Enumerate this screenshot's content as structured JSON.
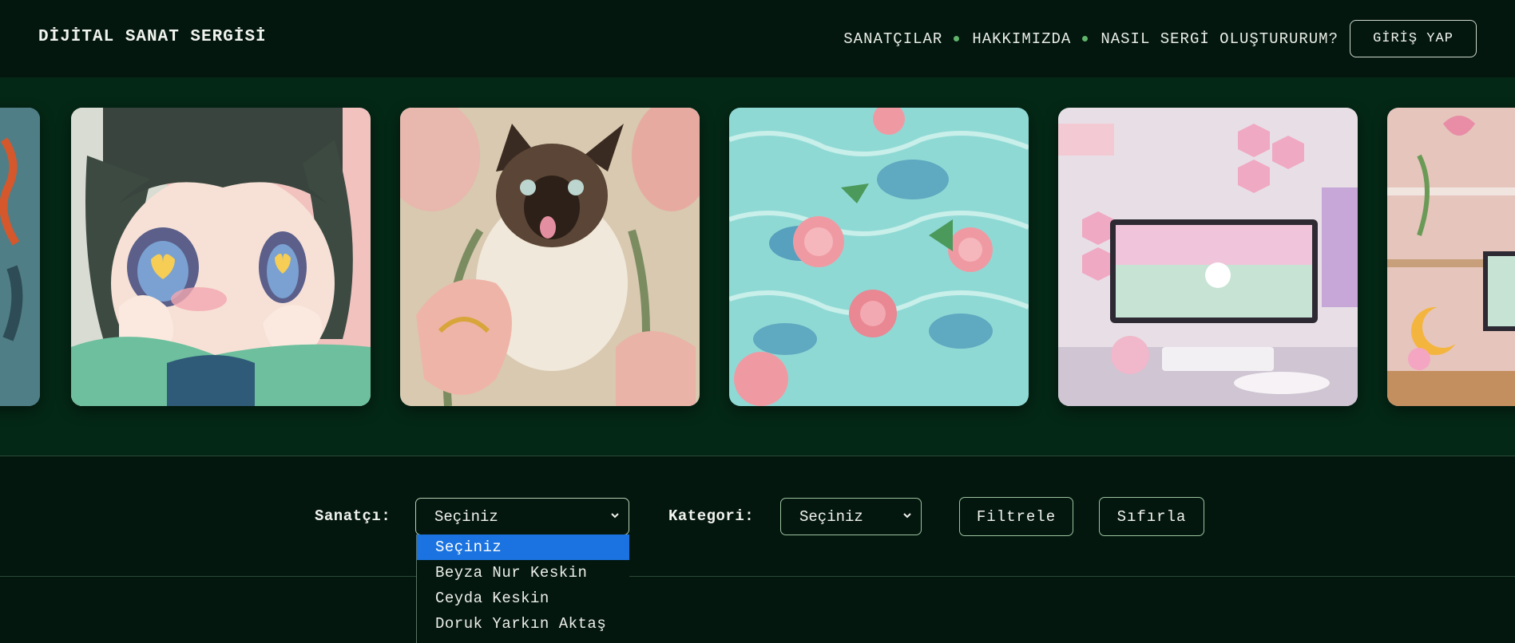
{
  "header": {
    "brand": "DİJİTAL SANAT SERGİSİ",
    "nav": [
      "SANATÇILAR",
      "HAKKIMIZDA",
      "NASIL SERGİ OLUŞTURURUM?"
    ],
    "login_label": "GİRİŞ YAP"
  },
  "gallery": {
    "items": [
      {
        "name": "artwork-partial-left"
      },
      {
        "name": "artwork-anime-girl"
      },
      {
        "name": "artwork-siamese-cat-tulips"
      },
      {
        "name": "artwork-roses-in-water"
      },
      {
        "name": "artwork-pink-gaming-setup"
      },
      {
        "name": "artwork-pink-room-partial"
      }
    ]
  },
  "filters": {
    "artist_label": "Sanatçı:",
    "artist_value": "Seçiniz",
    "category_label": "Kategori:",
    "category_value": "Seçiniz",
    "filter_button": "Filtrele",
    "reset_button": "Sıfırla",
    "artist_options": [
      "Seçiniz",
      "Beyza Nur Keskin",
      "Ceyda Keskin",
      "Doruk Yarkın Aktaş"
    ]
  },
  "colors": {
    "background": "#06170f",
    "gallery_band": "#042816",
    "accent_dot": "#5fb46a",
    "selected_option": "#1a73e0"
  }
}
